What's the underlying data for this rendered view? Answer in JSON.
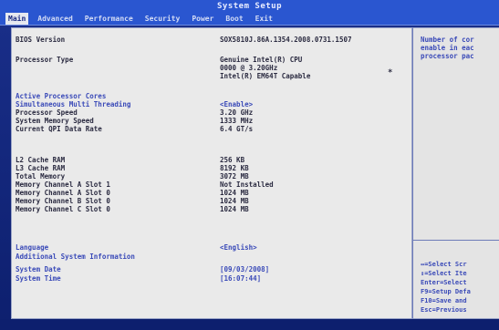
{
  "window": {
    "title": "System Setup"
  },
  "menu": {
    "items": [
      {
        "label": "Main",
        "active": true
      },
      {
        "label": "Advanced",
        "active": false
      },
      {
        "label": "Performance",
        "active": false
      },
      {
        "label": "Security",
        "active": false
      },
      {
        "label": "Power",
        "active": false
      },
      {
        "label": "Boot",
        "active": false
      },
      {
        "label": "Exit",
        "active": false
      }
    ]
  },
  "main": {
    "bios_version_label": "BIOS Version",
    "bios_version_value": "SOX5810J.86A.1354.2008.0731.1507",
    "processor_type_label": "Processor Type",
    "processor_type_line1": "Genuine Intel(R) CPU",
    "processor_type_line2": "0000 @ 3.20GHz",
    "processor_type_line3": "Intel(R) EM64T Capable",
    "active_cores_label": "Active Processor Cores",
    "smt_label": "Simultaneous Multi Threading",
    "smt_value": "<Enable>",
    "processor_speed_label": "Processor Speed",
    "processor_speed_value": "3.20 GHz",
    "memory_speed_label": "System Memory Speed",
    "memory_speed_value": "1333 MHz",
    "qpi_label": "Current QPI Data Rate",
    "qpi_value": "6.4 GT/s",
    "l2_label": "L2 Cache RAM",
    "l2_value": "256 KB",
    "l3_label": "L3 Cache RAM",
    "l3_value": "8192 KB",
    "total_memory_label": "Total Memory",
    "total_memory_value": "3072 MB",
    "slots": [
      {
        "label": "Memory Channel A Slot 1",
        "value": "Not Installed"
      },
      {
        "label": "Memory Channel A Slot 0",
        "value": "1024 MB"
      },
      {
        "label": "Memory Channel B Slot 0",
        "value": "1024 MB"
      },
      {
        "label": "Memory Channel C Slot 0",
        "value": "1024 MB"
      }
    ],
    "language_label": "Language",
    "language_value": "<English>",
    "additional_info_label": "Additional System Information",
    "system_date_label": "System Date",
    "system_date_value": "[09/03/2008]",
    "system_time_label": "System Time",
    "system_time_value": "[16:07:44]"
  },
  "help": {
    "lines": [
      "Number of cor",
      "enable in eac",
      "processor pac"
    ],
    "keys": [
      "↔=Select Scr",
      "↕=Select Ite",
      "Enter=Select",
      "F9=Setup Defa",
      "F10=Save and",
      "Esc=Previous"
    ]
  }
}
